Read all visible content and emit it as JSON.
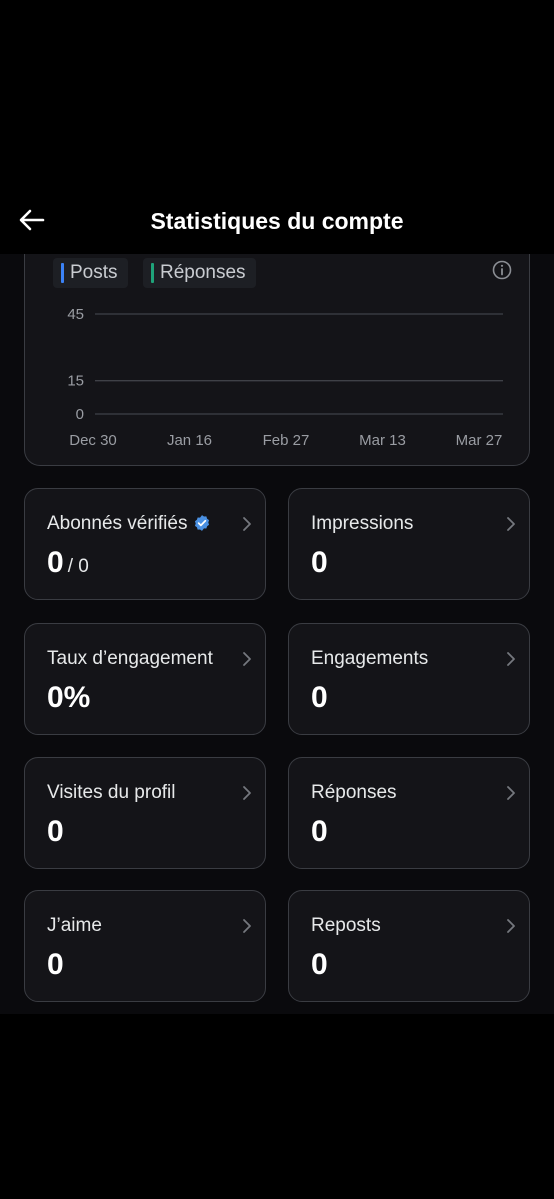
{
  "header": {
    "title": "Statistiques du compte"
  },
  "chart_data": {
    "type": "line",
    "legend": [
      "Posts",
      "Réponses"
    ],
    "series": [
      {
        "name": "Posts",
        "color": "#3b82f6",
        "values": [
          0,
          0,
          0,
          0,
          0
        ]
      },
      {
        "name": "Réponses",
        "color": "#1fa37a",
        "values": [
          0,
          0,
          0,
          0,
          0
        ]
      }
    ],
    "categories": [
      "Dec 30",
      "Jan 16",
      "Feb 27",
      "Mar 13",
      "Mar 27"
    ],
    "y_ticks": [
      "45",
      "15",
      "0"
    ],
    "grid": true,
    "legend_position": "top-left"
  },
  "stats": [
    {
      "label": "Abonnés vérifiés",
      "value": "0",
      "sub": "/ 0",
      "verified": true
    },
    {
      "label": "Impressions",
      "value": "0"
    },
    {
      "label": "Taux d’engagement",
      "value": "0%"
    },
    {
      "label": "Engagements",
      "value": "0"
    },
    {
      "label": "Visites du profil",
      "value": "0"
    },
    {
      "label": "Réponses",
      "value": "0"
    },
    {
      "label": "J’aime",
      "value": "0"
    },
    {
      "label": "Reposts",
      "value": "0"
    }
  ],
  "colors": {
    "background": "#000000",
    "card": "#141418",
    "card_border": "#3a3c42",
    "posts_accent": "#3b82f6",
    "replies_accent": "#1fa37a",
    "verified_badge": "#4a90e2"
  },
  "icons": {
    "back": "arrow-left-icon",
    "info": "info-circle-icon",
    "verified": "verified-badge-icon",
    "chevron": "chevron-right-icon"
  }
}
